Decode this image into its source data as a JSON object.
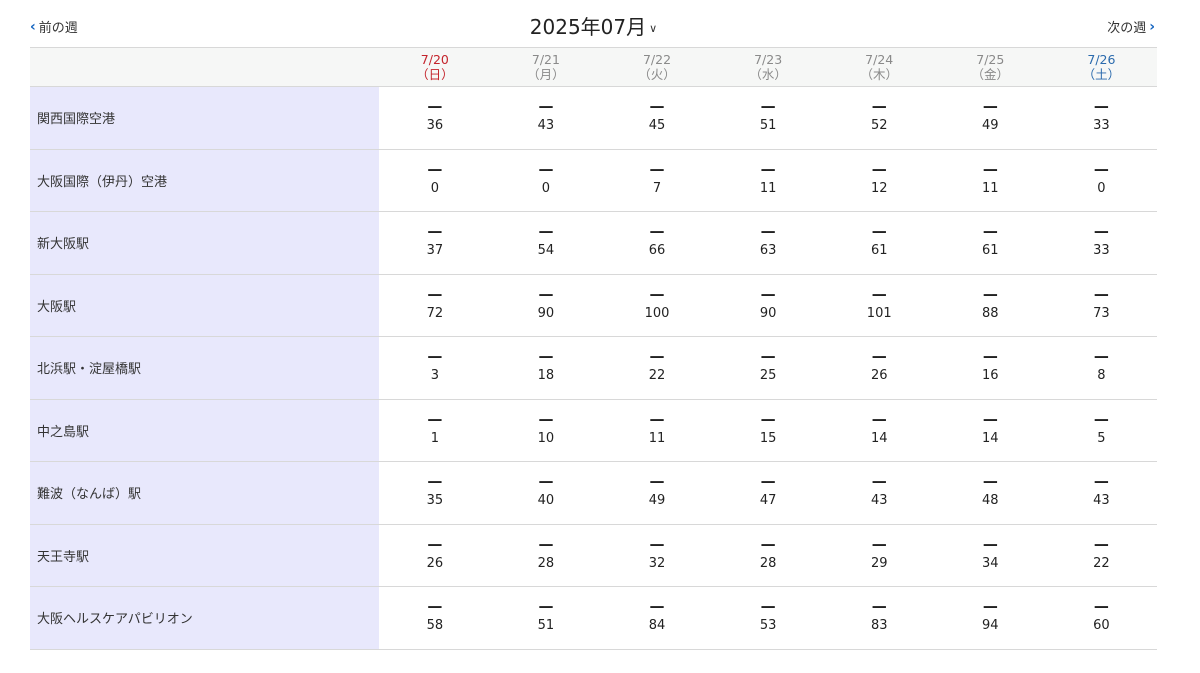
{
  "header": {
    "prev_week": "前の週",
    "next_week": "次の週",
    "month": "2025年07月"
  },
  "days": [
    {
      "date": "7/20",
      "weekday": "（日）",
      "type": "sun"
    },
    {
      "date": "7/21",
      "weekday": "（月）",
      "type": "weekday"
    },
    {
      "date": "7/22",
      "weekday": "（火）",
      "type": "weekday"
    },
    {
      "date": "7/23",
      "weekday": "（水）",
      "type": "weekday"
    },
    {
      "date": "7/24",
      "weekday": "（木）",
      "type": "weekday"
    },
    {
      "date": "7/25",
      "weekday": "（金）",
      "type": "weekday"
    },
    {
      "date": "7/26",
      "weekday": "（土）",
      "type": "sat"
    }
  ],
  "rows": [
    {
      "name": "関西国際空港",
      "values": [
        "36",
        "43",
        "45",
        "51",
        "52",
        "49",
        "33"
      ]
    },
    {
      "name": "大阪国際（伊丹）空港",
      "values": [
        "0",
        "0",
        "7",
        "11",
        "12",
        "11",
        "0"
      ]
    },
    {
      "name": "新大阪駅",
      "values": [
        "37",
        "54",
        "66",
        "63",
        "61",
        "61",
        "33"
      ]
    },
    {
      "name": "大阪駅",
      "values": [
        "72",
        "90",
        "100",
        "90",
        "101",
        "88",
        "73"
      ]
    },
    {
      "name": "北浜駅・淀屋橋駅",
      "values": [
        "3",
        "18",
        "22",
        "25",
        "26",
        "16",
        "8"
      ]
    },
    {
      "name": "中之島駅",
      "values": [
        "1",
        "10",
        "11",
        "15",
        "14",
        "14",
        "5"
      ]
    },
    {
      "name": "難波（なんば）駅",
      "values": [
        "35",
        "40",
        "49",
        "47",
        "43",
        "48",
        "43"
      ]
    },
    {
      "name": "天王寺駅",
      "values": [
        "26",
        "28",
        "32",
        "28",
        "29",
        "34",
        "22"
      ]
    },
    {
      "name": "大阪ヘルスケアパビリオン",
      "values": [
        "58",
        "51",
        "84",
        "53",
        "83",
        "94",
        "60"
      ]
    }
  ],
  "status_mark": "—",
  "colors": {
    "sunday": "#c4242c",
    "saturday": "#2a6aad",
    "name_column_bg": "#e8e8fc",
    "accent": "#1565c0"
  }
}
